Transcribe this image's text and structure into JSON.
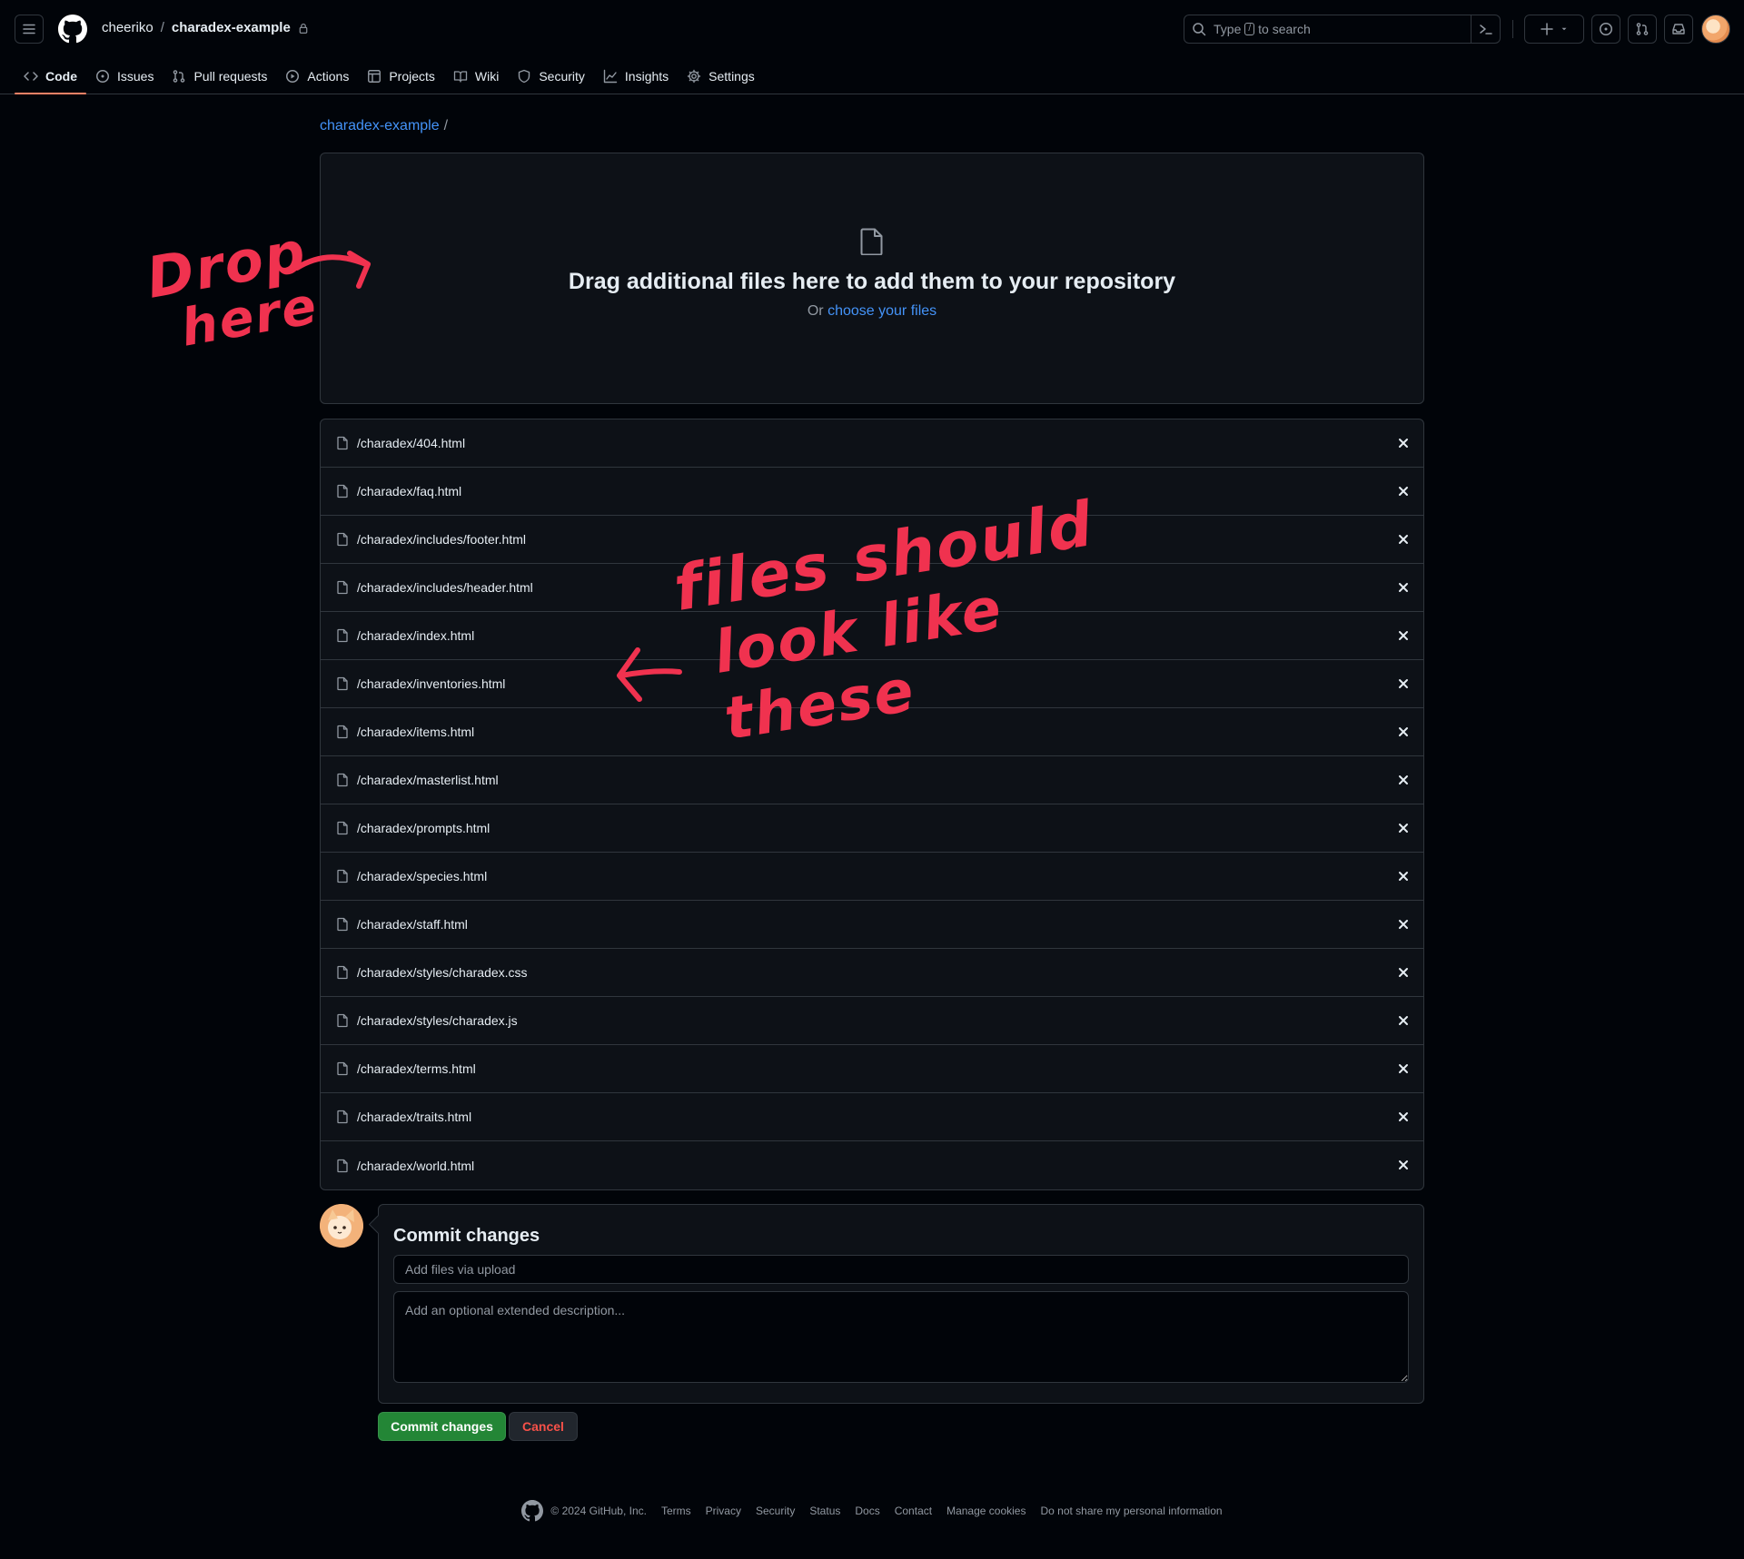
{
  "header": {
    "owner": "cheeriko",
    "separator": "/",
    "repo": "charadex-example",
    "search": {
      "prefix": "Type",
      "key": "/",
      "suffix": "to search"
    }
  },
  "tabs": [
    {
      "label": "Code",
      "icon": "code-icon",
      "active": true
    },
    {
      "label": "Issues",
      "icon": "issue-opened-icon"
    },
    {
      "label": "Pull requests",
      "icon": "git-pull-request-icon"
    },
    {
      "label": "Actions",
      "icon": "play-icon"
    },
    {
      "label": "Projects",
      "icon": "table-icon"
    },
    {
      "label": "Wiki",
      "icon": "book-icon"
    },
    {
      "label": "Security",
      "icon": "shield-icon"
    },
    {
      "label": "Insights",
      "icon": "graph-icon"
    },
    {
      "label": "Settings",
      "icon": "gear-icon"
    }
  ],
  "breadcrumb": {
    "repo": "charadex-example",
    "sep": "/"
  },
  "dropzone": {
    "title": "Drag additional files here to add them to your repository",
    "sub_prefix": "Or",
    "sub_link": "choose your files"
  },
  "files": [
    "/charadex/404.html",
    "/charadex/faq.html",
    "/charadex/includes/footer.html",
    "/charadex/includes/header.html",
    "/charadex/index.html",
    "/charadex/inventories.html",
    "/charadex/items.html",
    "/charadex/masterlist.html",
    "/charadex/prompts.html",
    "/charadex/species.html",
    "/charadex/staff.html",
    "/charadex/styles/charadex.css",
    "/charadex/styles/charadex.js",
    "/charadex/terms.html",
    "/charadex/traits.html",
    "/charadex/world.html"
  ],
  "commit": {
    "title": "Commit changes",
    "summary_placeholder": "Add files via upload",
    "description_placeholder": "Add an optional extended description...",
    "commit_button": "Commit changes",
    "cancel_button": "Cancel"
  },
  "footer": {
    "copyright": "© 2024 GitHub, Inc.",
    "links": [
      "Terms",
      "Privacy",
      "Security",
      "Status",
      "Docs",
      "Contact",
      "Manage cookies",
      "Do not share my personal information"
    ]
  },
  "annotations": {
    "drop_line1": "Drop",
    "drop_line2": "here",
    "files_line1": "files should",
    "files_line2": "look like these"
  },
  "colors": {
    "bg": "#010409",
    "panel": "#0d1117",
    "border": "#30363d",
    "link": "#4493f8",
    "tab_underline": "#f78166",
    "commit_green": "#238636",
    "cancel_red": "#f85149",
    "annotation_red": "#f0324f"
  }
}
